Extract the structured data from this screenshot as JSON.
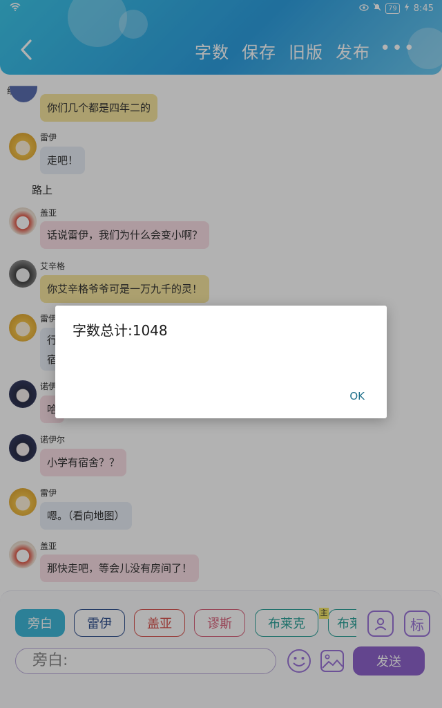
{
  "status_bar": {
    "battery": "79",
    "time": "8:45"
  },
  "header": {
    "actions": [
      "字数",
      "保存",
      "旧版",
      "发布"
    ],
    "more": "•••"
  },
  "chat": {
    "shrink_label": "缩小",
    "messages": [
      {
        "kind": "msg",
        "name": "",
        "text": "你们几个都是四年二的",
        "bubble_color": "#f6e6a0",
        "avatar": "blue"
      },
      {
        "kind": "msg",
        "name": "雷伊",
        "text": "走吧！",
        "bubble_color": "#e8eef6",
        "avatar": "yellow"
      },
      {
        "kind": "narration",
        "text": "路上"
      },
      {
        "kind": "msg",
        "name": "盖亚",
        "text": "话说雷伊，我们为什么会变小啊？",
        "bubble_color": "#f9dfe6",
        "avatar": "red"
      },
      {
        "kind": "msg",
        "name": "艾辛格",
        "text": "你艾辛格爷爷可是一万九千的灵！",
        "bubble_color": "#f6e6a0",
        "avatar": "dark"
      },
      {
        "kind": "msg",
        "name": "雷伊",
        "text": "行",
        "text2": "宿",
        "bubble_color": "#e8eef6",
        "avatar": "yellow"
      },
      {
        "kind": "msg",
        "name": "诺伊",
        "text": "哈",
        "bubble_color": "#f9dfe6",
        "avatar": "navy"
      },
      {
        "kind": "msg",
        "name": "诺伊尔",
        "text": "小学有宿舍？？",
        "bubble_color": "#f9dfe6",
        "avatar": "navy"
      },
      {
        "kind": "msg",
        "name": "雷伊",
        "text": "嗯。（看向地图）",
        "bubble_color": "#e8eef6",
        "avatar": "yellow"
      },
      {
        "kind": "msg",
        "name": "盖亚",
        "text": "那快走吧，等会儿没有房间了！",
        "bubble_color": "#f9dfe6",
        "avatar": "red"
      }
    ]
  },
  "panel": {
    "chips": [
      {
        "label": "旁白",
        "color": "#3fb8d8",
        "filled": true
      },
      {
        "label": "雷伊",
        "color": "#2f4f8f",
        "filled": false
      },
      {
        "label": "盖亚",
        "color": "#d9534f",
        "filled": false
      },
      {
        "label": "谬斯",
        "color": "#d9607a",
        "filled": false
      },
      {
        "label": "布莱克",
        "color": "#2aa198",
        "filled": false
      },
      {
        "label": "布莱",
        "color": "#2aa198",
        "filled": false
      }
    ],
    "chip_badge": "主",
    "side_icon_label": "标",
    "input_placeholder": "旁白:",
    "send_label": "发送"
  },
  "dialog": {
    "title": "字数总计:1048",
    "ok_label": "OK"
  }
}
